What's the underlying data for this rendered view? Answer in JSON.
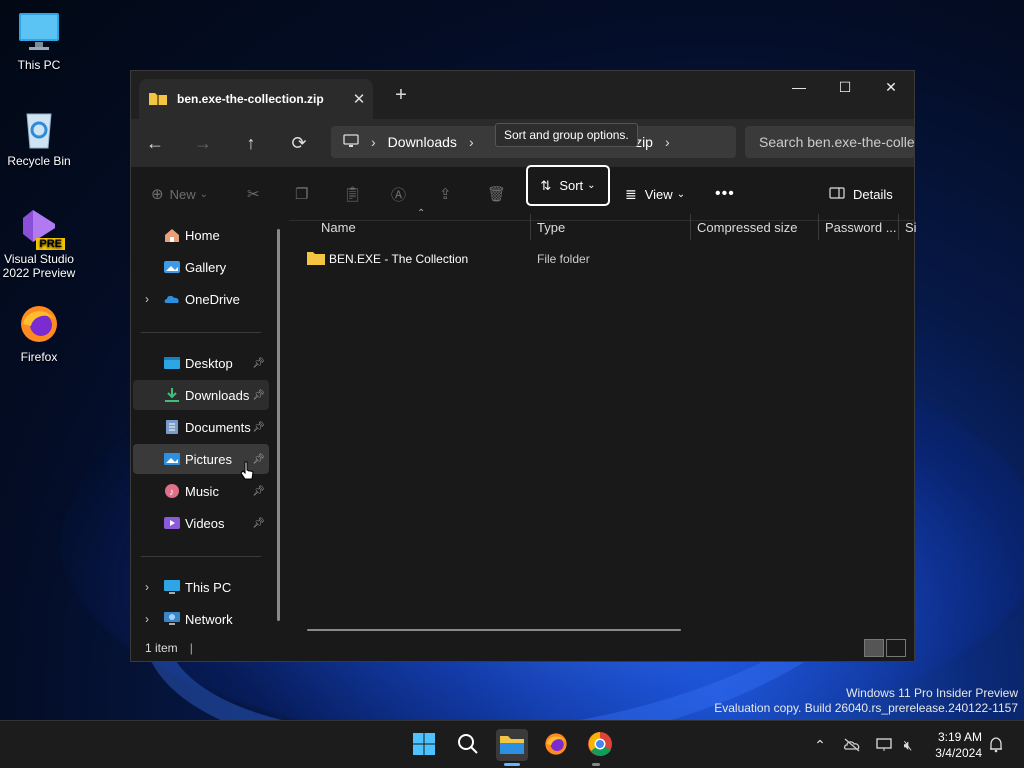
{
  "desktop": {
    "icons": [
      {
        "label": "This PC"
      },
      {
        "label": "Recycle Bin"
      },
      {
        "label": "Visual Studio 2022 Preview",
        "badge": "PRE"
      },
      {
        "label": "Firefox"
      }
    ]
  },
  "window": {
    "tab_title": "ben.exe-the-collection.zip",
    "tab_close": "✕",
    "new_tab": "+",
    "controls": {
      "minimize": "—",
      "maximize": "☐",
      "close": "✕"
    },
    "address": {
      "segments": [
        "Downloads",
        "on.zip"
      ],
      "tooltip": "Sort and group options."
    },
    "search_placeholder": "Search ben.exe-the-collec",
    "toolbar": {
      "new_label": "New",
      "sort_label": "Sort",
      "view_label": "View",
      "more_label": "•••",
      "details_label": "Details"
    },
    "sidebar": {
      "items": [
        {
          "label": "Home"
        },
        {
          "label": "Gallery"
        },
        {
          "label": "OneDrive"
        },
        {
          "label": "Desktop"
        },
        {
          "label": "Downloads"
        },
        {
          "label": "Documents"
        },
        {
          "label": "Pictures"
        },
        {
          "label": "Music"
        },
        {
          "label": "Videos"
        },
        {
          "label": "This PC"
        },
        {
          "label": "Network"
        }
      ]
    },
    "columns": [
      "Name",
      "Type",
      "Compressed size",
      "Password ...",
      "Si"
    ],
    "rows": [
      {
        "name": "BEN.EXE - The Collection",
        "type": "File folder"
      }
    ],
    "status": "1 item"
  },
  "watermark": {
    "line1": "Windows 11 Pro Insider Preview",
    "line2": "Evaluation copy. Build 26040.rs_prerelease.240122-1157"
  },
  "clock": {
    "time": "3:19 AM",
    "date": "3/4/2024"
  },
  "colors": {
    "accent": "#6cb2ff",
    "folder": "#f3c542"
  }
}
